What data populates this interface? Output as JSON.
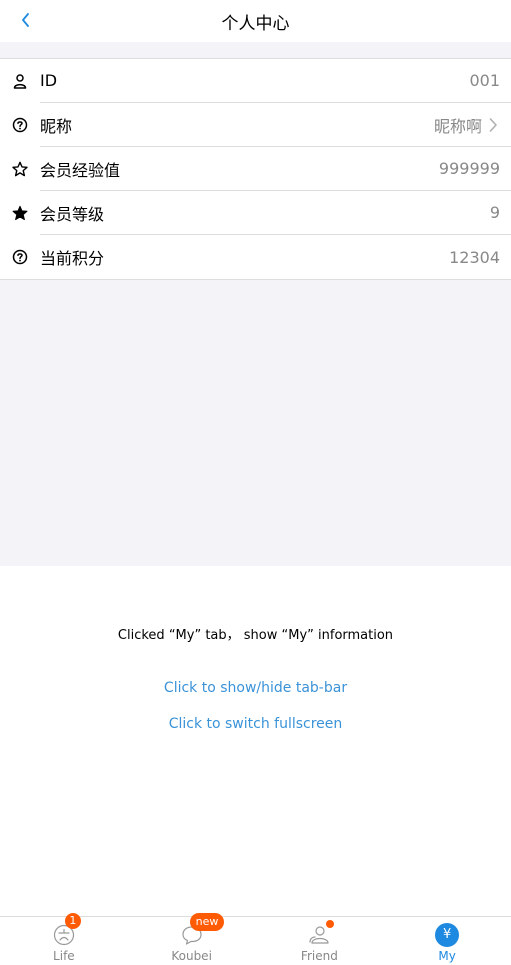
{
  "header": {
    "title": "个人中心",
    "back_icon": "chevron-left-icon"
  },
  "profile": {
    "rows": [
      {
        "icon": "user-icon",
        "label": "ID",
        "value": "001"
      },
      {
        "icon": "help-circle-icon",
        "label": "昵称",
        "value": "昵称啊"
      },
      {
        "icon": "star-outline-icon",
        "label": "会员经验值",
        "value": "999999"
      },
      {
        "icon": "star-filled-icon",
        "label": "会员等级",
        "value": "9"
      },
      {
        "icon": "help-circle-icon",
        "label": "当前积分",
        "value": "12304"
      }
    ]
  },
  "content": {
    "info_text": "Clicked “My” tab， show “My” information",
    "toggle_tabbar_link": "Click to show/hide tab-bar",
    "fullscreen_link": "Click to switch fullscreen"
  },
  "tabbar": {
    "tabs": [
      {
        "label": "Life",
        "icon": "life-icon",
        "badge": "1"
      },
      {
        "label": "Koubei",
        "icon": "koubei-icon",
        "badge": "new"
      },
      {
        "label": "Friend",
        "icon": "friend-icon",
        "dot": true
      },
      {
        "label": "My",
        "icon": "yen-icon",
        "icon_text": "¥",
        "active": true
      }
    ]
  },
  "colors": {
    "accent": "#1e89e0",
    "link": "#3a93d8",
    "badge": "#ff5b05",
    "background": "#f3f3f8"
  }
}
